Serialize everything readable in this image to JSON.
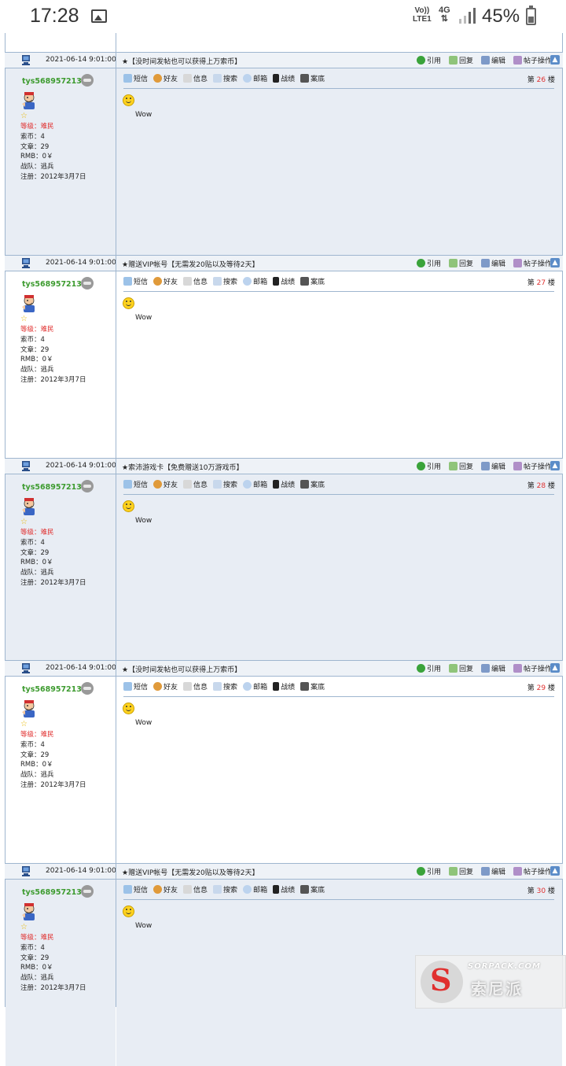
{
  "status_bar": {
    "time": "17:28",
    "network_top": "Vo))",
    "network_bottom": "LTE1",
    "data_type": "4G",
    "battery_percent": "45%",
    "battery_level": 0.45
  },
  "toolbar": {
    "sms": "短信",
    "friend": "好友",
    "info": "信息",
    "search": "搜索",
    "mail": "邮箱",
    "battle": "战绩",
    "bottom": "案底"
  },
  "actions": {
    "quote": "引用",
    "reply": "回复",
    "edit": "编辑",
    "post_ops": "帖子操作"
  },
  "user": {
    "name": "tys568957213",
    "level_label": "等级：",
    "level_value": "难民",
    "coins": "索币：4",
    "articles": "文章：29",
    "rmb": "RMB：0￥",
    "team": "战队：逃兵",
    "registered": "注册：2012年3月7日"
  },
  "posts": [
    {
      "date": "2021-06-14 9:01:00",
      "title": "★【没时间发帖也可以获得上万索币】",
      "floor_prefix": "第",
      "floor": "26",
      "floor_suffix": "楼",
      "body": "Wow"
    },
    {
      "date": "2021-06-14 9:01:00",
      "title": "★赠送VIP帐号【无需发20贴以及等待2天】",
      "floor_prefix": "第",
      "floor": "27",
      "floor_suffix": "楼",
      "body": "Wow"
    },
    {
      "date": "2021-06-14 9:01:00",
      "title": "★索沛游戏卡【免费赠送10万游戏币】",
      "floor_prefix": "第",
      "floor": "28",
      "floor_suffix": "楼",
      "body": "Wow"
    },
    {
      "date": "2021-06-14 9:01:00",
      "title": "★【没时间发帖也可以获得上万索币】",
      "floor_prefix": "第",
      "floor": "29",
      "floor_suffix": "楼",
      "body": "Wow"
    },
    {
      "date": "2021-06-14 9:01:00",
      "title": "★赠送VIP帐号【无需发20贴以及等待2天】",
      "floor_prefix": "第",
      "floor": "30",
      "floor_suffix": "楼",
      "body": "Wow"
    }
  ],
  "watermark": {
    "url": "SORPACK.COM",
    "cn": "索尼派"
  },
  "colors": {
    "username": "#3d9b2f",
    "floor_number": "#e0302f",
    "level": "#e0302f",
    "row_blue": "#e8edf4",
    "border": "#9fb6cf"
  }
}
